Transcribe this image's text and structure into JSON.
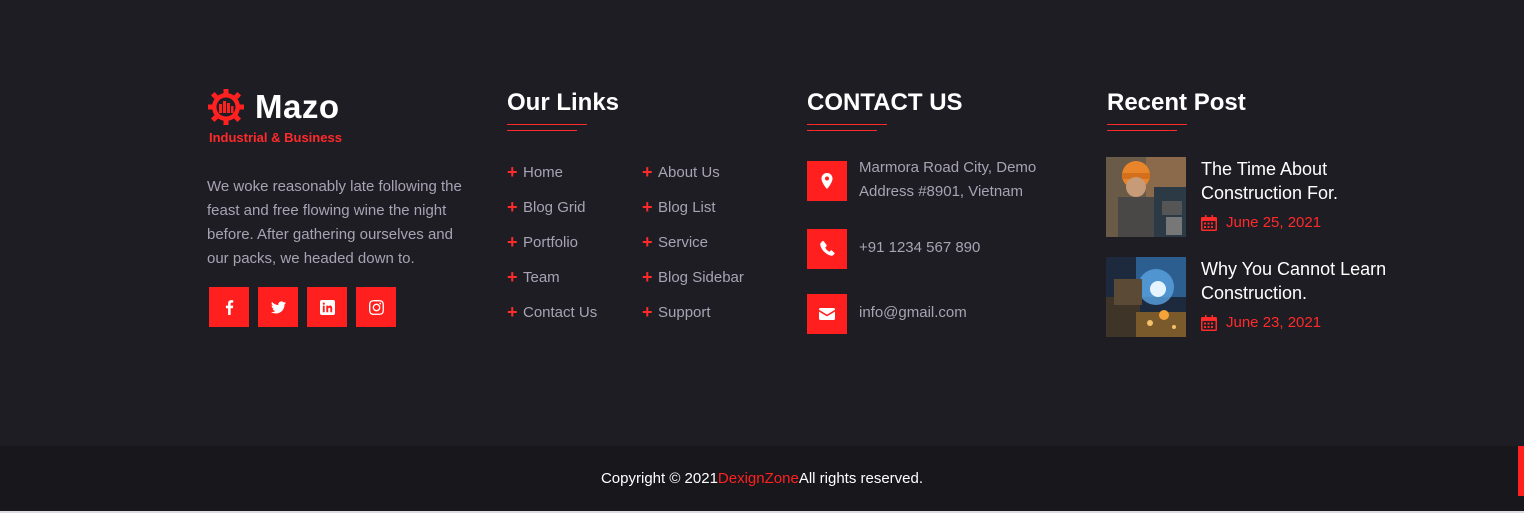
{
  "brand": {
    "name": "Mazo",
    "tagline": "Industrial & Business",
    "about": "We woke reasonably late following the feast and free flowing wine the night before. After gathering ourselves and our packs, we headed down to."
  },
  "socials": [
    {
      "name": "facebook-icon"
    },
    {
      "name": "twitter-icon"
    },
    {
      "name": "linkedin-icon"
    },
    {
      "name": "instagram-icon"
    }
  ],
  "links": {
    "title": "Our Links",
    "col1": [
      "Home",
      "Blog Grid",
      "Portfolio",
      "Team",
      "Contact Us"
    ],
    "col2": [
      "About Us",
      "Blog List",
      "Service",
      "Blog Sidebar",
      "Support"
    ]
  },
  "contact": {
    "title": "CONTACT US",
    "address": "Marmora Road City, Demo Address #8901, Vietnam",
    "phone": "+91 1234 567 890",
    "email": "info@gmail.com"
  },
  "recent": {
    "title": "Recent Post",
    "posts": [
      {
        "title": "The Time About Construction For.",
        "date": "June 25, 2021"
      },
      {
        "title": "Why You Cannot Learn Construction.",
        "date": "June 23, 2021"
      }
    ]
  },
  "footer": {
    "copyright_prefix": "Copyright © 2021",
    "company": "DexignZone",
    "suffix": "All rights reserved."
  },
  "colors": {
    "accent": "#ff1f1f",
    "background": "#1f1d24",
    "bottom_bar": "#18171c",
    "muted_text": "#a7a3b3"
  }
}
